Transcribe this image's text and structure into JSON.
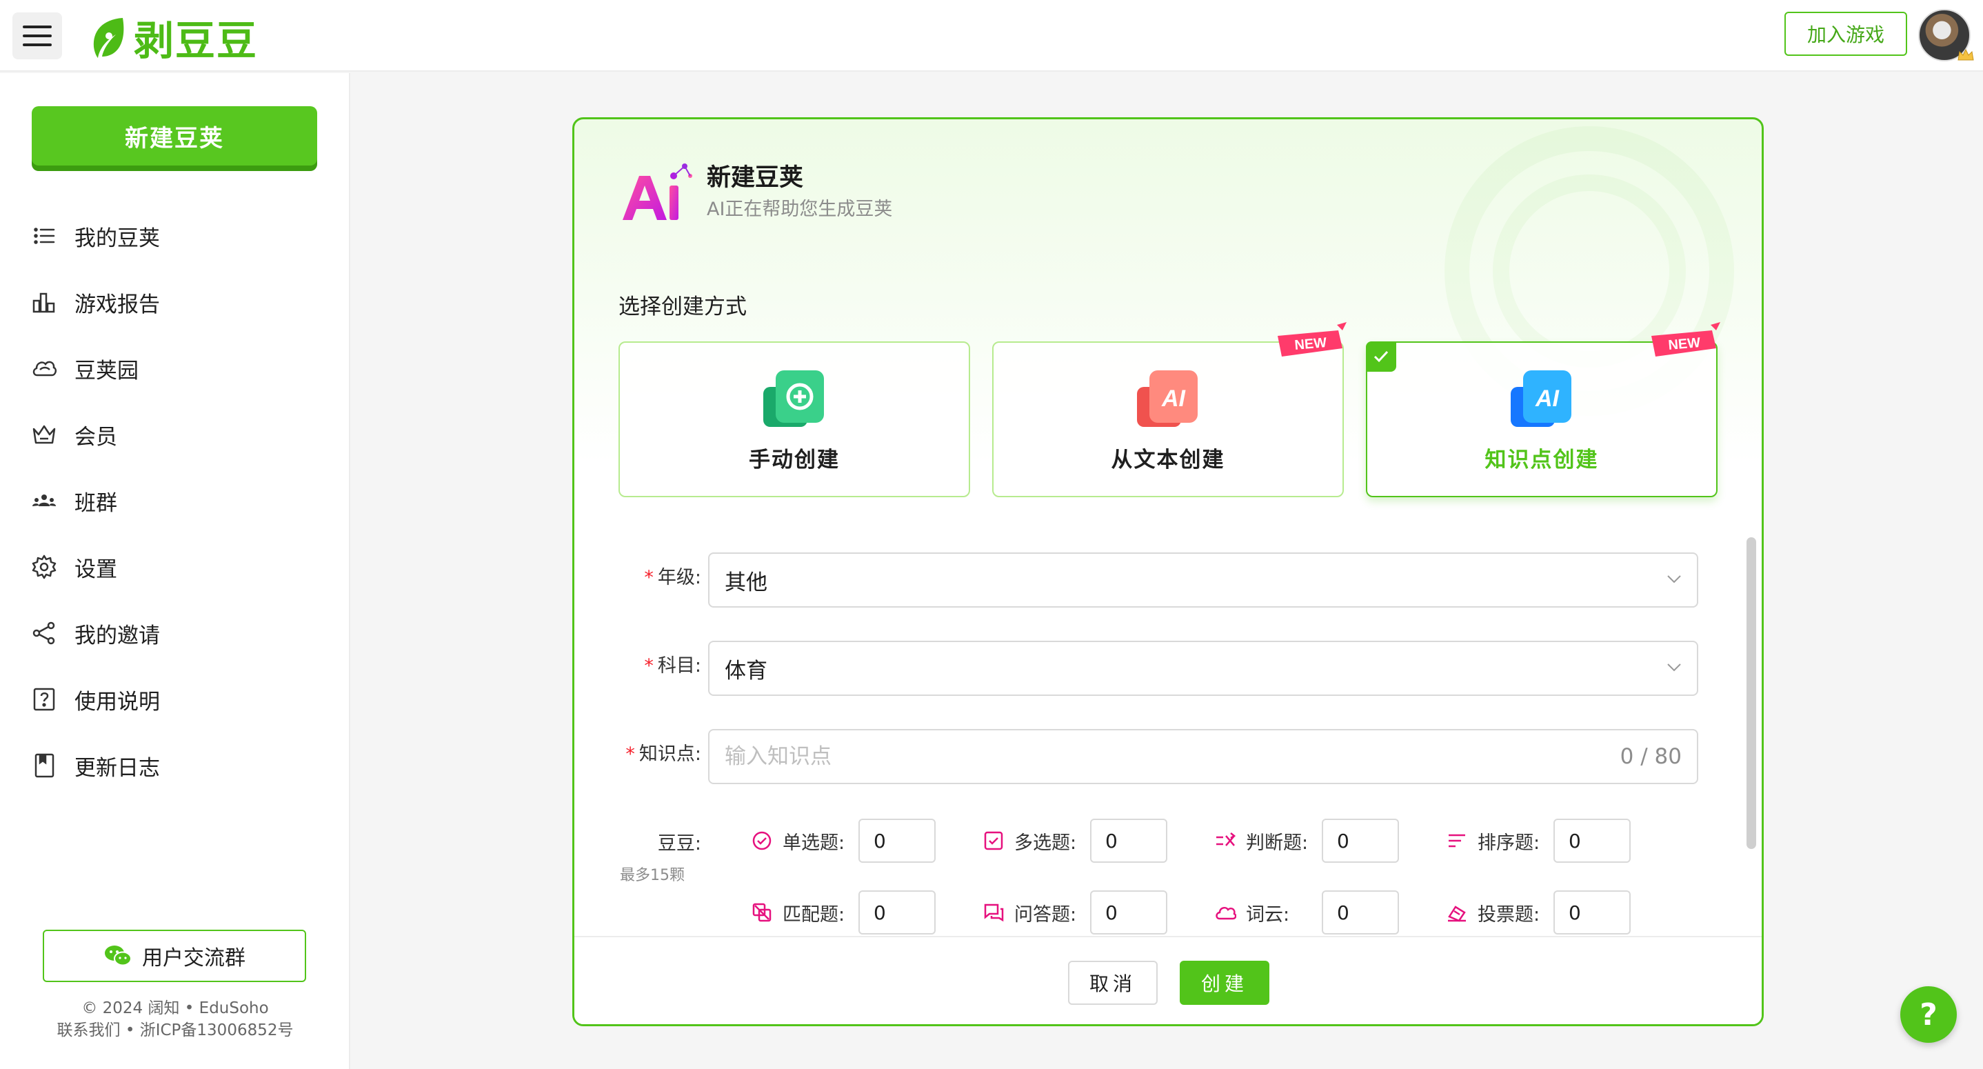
{
  "app": {
    "logo_text": "剥豆豆",
    "join_game": "加入游戏",
    "help": "?"
  },
  "sidebar": {
    "new_button": "新建豆荚",
    "items": [
      {
        "label": "我的豆荚",
        "icon": "list-icon"
      },
      {
        "label": "游戏报告",
        "icon": "bar-chart-icon"
      },
      {
        "label": "豆荚园",
        "icon": "cloud-icon"
      },
      {
        "label": "会员",
        "icon": "crown-icon"
      },
      {
        "label": "班群",
        "icon": "group-icon"
      },
      {
        "label": "设置",
        "icon": "gear-icon"
      },
      {
        "label": "我的邀请",
        "icon": "share-icon"
      },
      {
        "label": "使用说明",
        "icon": "help-square-icon"
      },
      {
        "label": "更新日志",
        "icon": "book-icon"
      }
    ],
    "community_button": "用户交流群",
    "copyright": "© 2024 阔知 • EduSoho",
    "contact": "联系我们 • 浙ICP备13006852号"
  },
  "card": {
    "title": "新建豆荚",
    "subtitle": "AI正在帮助您生成豆荚",
    "choose_label": "选择创建方式",
    "modes": [
      {
        "label": "手动创建",
        "icon": "plus-doc-icon",
        "selected": false,
        "badge": ""
      },
      {
        "label": "从文本创建",
        "icon": "ai-red-icon",
        "selected": false,
        "badge": "NEW"
      },
      {
        "label": "知识点创建",
        "icon": "ai-blue-icon",
        "selected": true,
        "badge": "NEW"
      }
    ],
    "form": {
      "grade_label": "年级:",
      "grade_value": "其他",
      "subject_label": "科目:",
      "subject_value": "体育",
      "knowledge_label": "知识点:",
      "knowledge_placeholder": "输入知识点",
      "knowledge_value": "",
      "knowledge_counter": "0 / 80",
      "beans_label": "豆豆:",
      "beans_hint": "最多15颗",
      "required_mark": "*"
    },
    "question_types": [
      {
        "label": "单选题:",
        "value": "0",
        "icon": "radio-check-icon"
      },
      {
        "label": "多选题:",
        "value": "0",
        "icon": "checkbox-icon"
      },
      {
        "label": "判断题:",
        "value": "0",
        "icon": "judge-icon"
      },
      {
        "label": "排序题:",
        "value": "0",
        "icon": "sort-icon"
      },
      {
        "label": "匹配题:",
        "value": "0",
        "icon": "match-icon"
      },
      {
        "label": "问答题:",
        "value": "0",
        "icon": "chat-icon"
      },
      {
        "label": "词云:",
        "value": "0",
        "icon": "word-cloud-icon"
      },
      {
        "label": "投票题:",
        "value": "0",
        "icon": "vote-icon"
      }
    ],
    "cancel": "取消",
    "create": "创建"
  },
  "colors": {
    "brand_green": "#52c41a",
    "question_icon": "#e6117e",
    "required": "#f5222d"
  }
}
